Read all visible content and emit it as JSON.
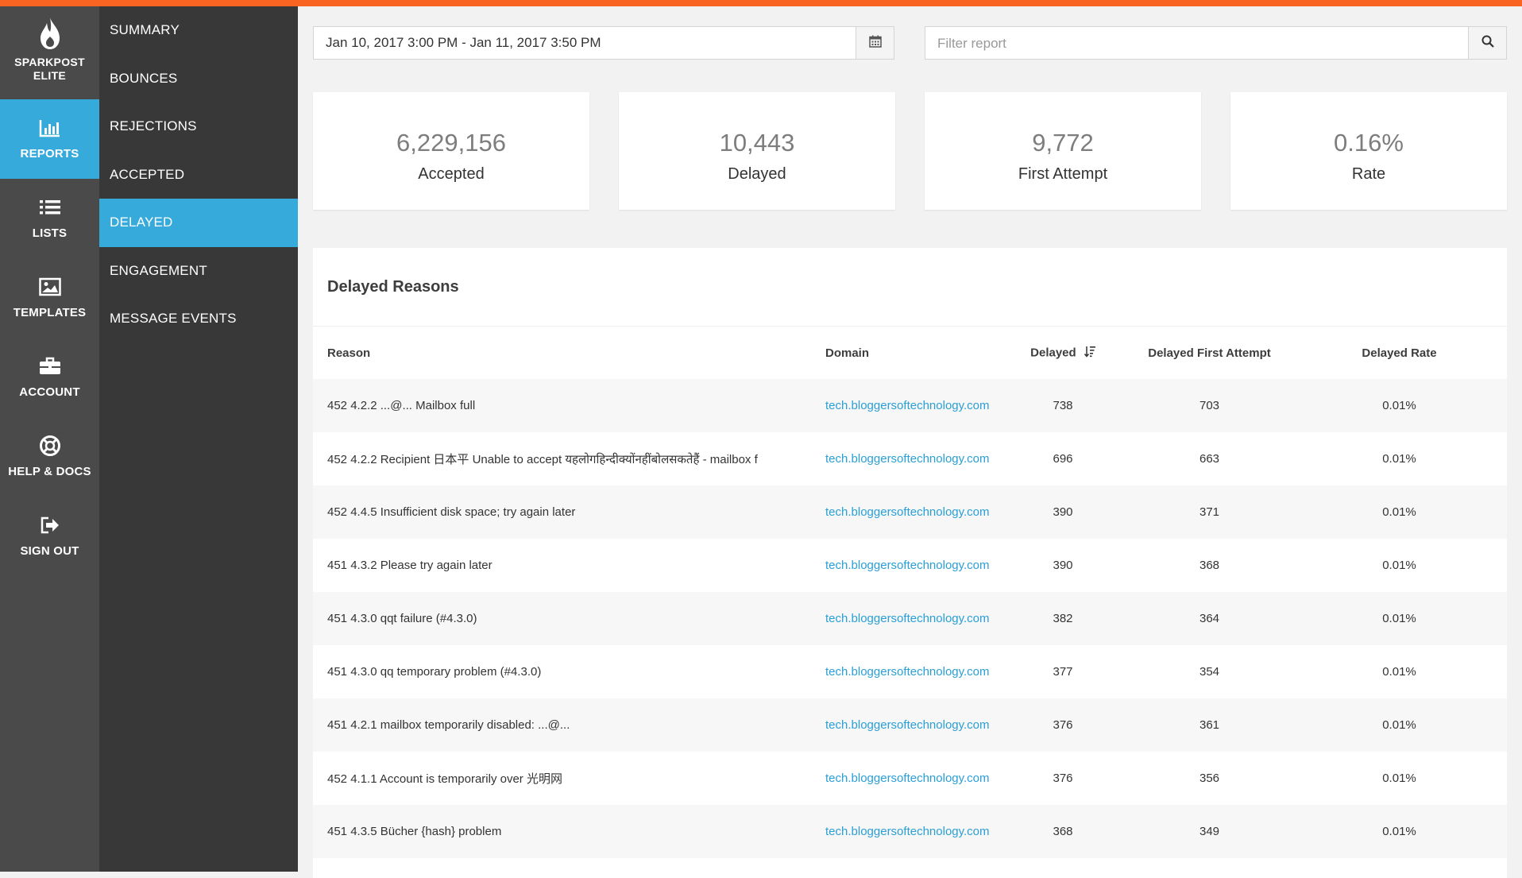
{
  "brand": {
    "line1": "SPARKPOST",
    "line2": "ELITE"
  },
  "rail": [
    {
      "label": "REPORTS",
      "icon": "bar-chart-icon",
      "active": true
    },
    {
      "label": "LISTS",
      "icon": "list-icon",
      "active": false
    },
    {
      "label": "TEMPLATES",
      "icon": "image-icon",
      "active": false
    },
    {
      "label": "ACCOUNT",
      "icon": "briefcase-icon",
      "active": false
    },
    {
      "label": "HELP & DOCS",
      "icon": "lifebuoy-icon",
      "active": false
    },
    {
      "label": "SIGN OUT",
      "icon": "sign-out-icon",
      "active": false
    }
  ],
  "subnav": [
    {
      "label": "SUMMARY",
      "active": false
    },
    {
      "label": "BOUNCES",
      "active": false
    },
    {
      "label": "REJECTIONS",
      "active": false
    },
    {
      "label": "ACCEPTED",
      "active": false
    },
    {
      "label": "DELAYED",
      "active": true
    },
    {
      "label": "ENGAGEMENT",
      "active": false
    },
    {
      "label": "MESSAGE EVENTS",
      "active": false
    }
  ],
  "date_range": {
    "value": "Jan 10, 2017 3:00 PM - Jan 11, 2017 3:50 PM",
    "icon": "calendar-icon"
  },
  "filter": {
    "placeholder": "Filter report",
    "icon": "search-icon"
  },
  "metrics": [
    {
      "value": "6,229,156",
      "label": "Accepted"
    },
    {
      "value": "10,443",
      "label": "Delayed"
    },
    {
      "value": "9,772",
      "label": "First Attempt"
    },
    {
      "value": "0.16%",
      "label": "Rate"
    }
  ],
  "table": {
    "title": "Delayed Reasons",
    "columns": [
      "Reason",
      "Domain",
      "Delayed",
      "Delayed First Attempt",
      "Delayed Rate"
    ],
    "sort_icon": "sort-descending-icon",
    "rows": [
      {
        "reason": "452 4.2.2 ...@... Mailbox full",
        "domain": "tech.bloggersoftechnology.com",
        "delayed": "738",
        "first": "703",
        "rate": "0.01%"
      },
      {
        "reason": "452 4.2.2 Recipient 日本平 Unable to accept यहलोगहिन्दीक्योंनहींबोलसकतेहैं - mailbox f",
        "domain": "tech.bloggersoftechnology.com",
        "delayed": "696",
        "first": "663",
        "rate": "0.01%"
      },
      {
        "reason": "452 4.4.5 Insufficient disk space; try again later",
        "domain": "tech.bloggersoftechnology.com",
        "delayed": "390",
        "first": "371",
        "rate": "0.01%"
      },
      {
        "reason": "451 4.3.2 Please try again later",
        "domain": "tech.bloggersoftechnology.com",
        "delayed": "390",
        "first": "368",
        "rate": "0.01%"
      },
      {
        "reason": "451 4.3.0 qqt failure (#4.3.0)",
        "domain": "tech.bloggersoftechnology.com",
        "delayed": "382",
        "first": "364",
        "rate": "0.01%"
      },
      {
        "reason": "451 4.3.0 qq temporary problem (#4.3.0)",
        "domain": "tech.bloggersoftechnology.com",
        "delayed": "377",
        "first": "354",
        "rate": "0.01%"
      },
      {
        "reason": "451 4.2.1 mailbox temporarily disabled: ...@...",
        "domain": "tech.bloggersoftechnology.com",
        "delayed": "376",
        "first": "361",
        "rate": "0.01%"
      },
      {
        "reason": "452 4.1.1 Account is temporarily over 光明网",
        "domain": "tech.bloggersoftechnology.com",
        "delayed": "376",
        "first": "356",
        "rate": "0.01%"
      },
      {
        "reason": "451 4.3.5 Bücher {hash} problem",
        "domain": "tech.bloggersoftechnology.com",
        "delayed": "368",
        "first": "349",
        "rate": "0.01%"
      },
      {
        "reason": "",
        "domain": "",
        "delayed": "",
        "first": "",
        "rate": ""
      }
    ]
  },
  "colors": {
    "accent": "#37aadc",
    "topbar": "#fa6423",
    "link": "#2a9fd6",
    "rail": "#4a4a4a",
    "subnav": "#383838"
  }
}
